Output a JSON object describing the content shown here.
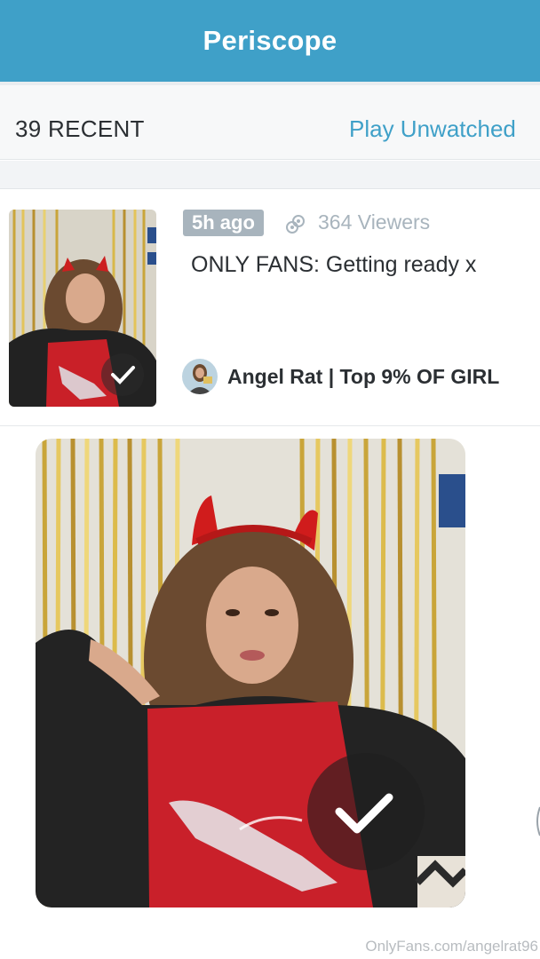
{
  "nav": {
    "title": "Periscope"
  },
  "filter": {
    "recent_count": "39 RECENT",
    "play_unwatched": "Play Unwatched"
  },
  "broadcast": {
    "time_badge": "5h ago",
    "viewers": "364 Viewers",
    "title": "ONLY FANS: Getting ready x",
    "username": "Angel Rat | Top 9% OF GIRL",
    "watched": true
  },
  "watermark": "OnlyFans.com/angelrat96",
  "colors": {
    "brand": "#3fa0c8",
    "badge": "#a8b4bd",
    "text": "#2b2f33"
  },
  "icons": {
    "viewers": "viewers-icon",
    "check": "check-icon"
  }
}
